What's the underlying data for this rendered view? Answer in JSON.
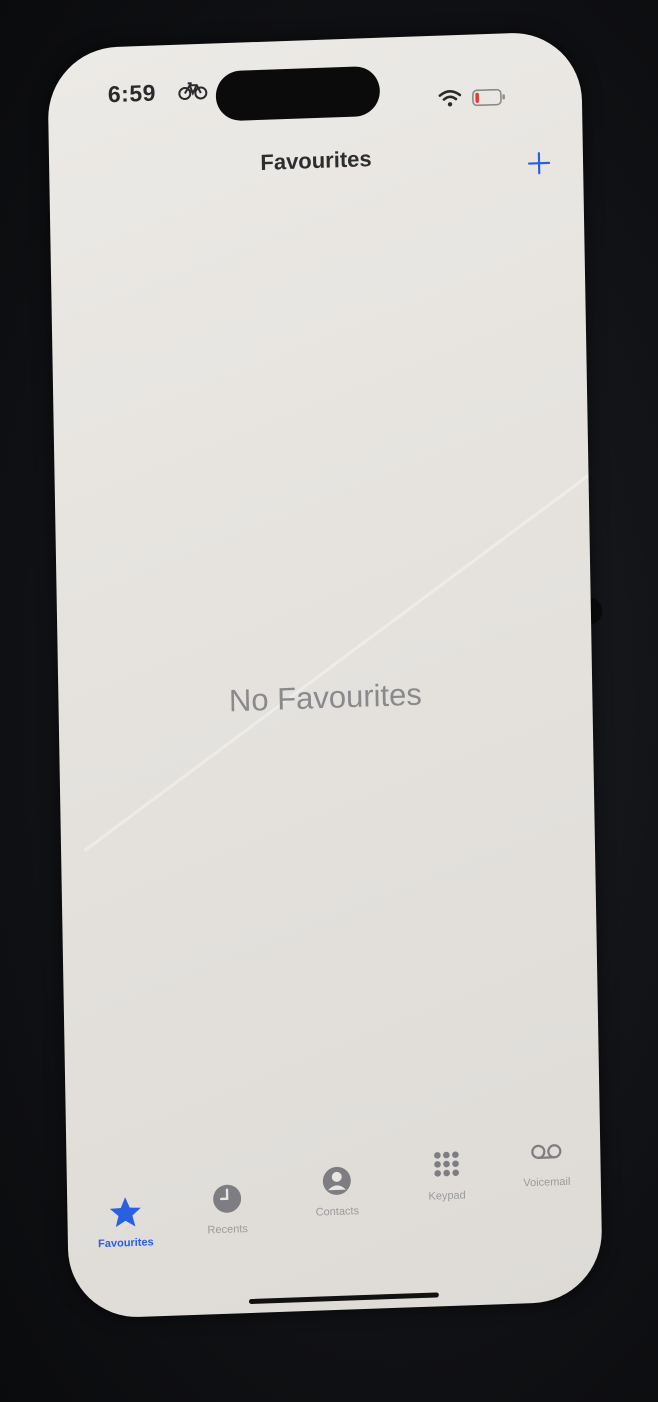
{
  "status_bar": {
    "time": "6:59",
    "activity_icon": "bicycle-icon",
    "wifi_icon": "wifi-icon",
    "battery_icon": "battery-low-icon"
  },
  "nav": {
    "title": "Favourites",
    "add_icon": "plus-icon"
  },
  "empty_state": {
    "message": "No Favourites"
  },
  "tabs": [
    {
      "label": "Favourites",
      "icon": "star-icon",
      "active": true
    },
    {
      "label": "Recents",
      "icon": "clock-icon",
      "active": false
    },
    {
      "label": "Contacts",
      "icon": "person-circle-icon",
      "active": false
    },
    {
      "label": "Keypad",
      "icon": "keypad-icon",
      "active": false
    },
    {
      "label": "Voicemail",
      "icon": "voicemail-icon",
      "active": false
    }
  ],
  "colors": {
    "accent": "#2a5fe0",
    "inactive": "#8e8e93",
    "background": "#e8e6e2"
  }
}
